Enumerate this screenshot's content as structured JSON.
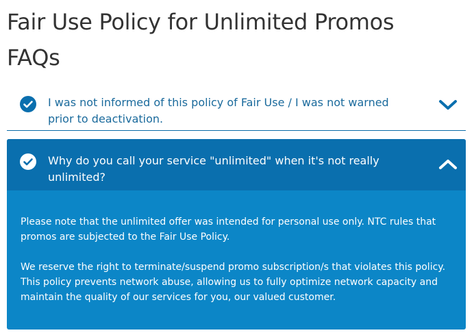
{
  "page": {
    "title": "Fair Use Policy for Unlimited Promos FAQs"
  },
  "colors": {
    "accent": "#0a6fae",
    "panel": "#0c86c7",
    "link_text": "#1a6a9c"
  },
  "faqs": [
    {
      "question": "I was not informed of this policy of Fair Use / I was not warned prior to deactivation.",
      "expanded": false,
      "check_icon": "check-circle-icon",
      "toggle_icon": "chevron-down-icon"
    },
    {
      "question": "Why do you call your service \"unlimited\" when it's not really unlimited?",
      "expanded": true,
      "check_icon": "check-circle-icon",
      "toggle_icon": "chevron-up-icon",
      "answer": [
        "Please note that the unlimited offer was intended for personal use only. NTC rules that promos are subjected to the Fair Use Policy.",
        "We reserve the right to terminate/suspend promo subscription/s that violates this policy. This policy prevents network abuse, allowing us to fully optimize network capacity and maintain the quality of our services for you, our valued customer."
      ]
    }
  ]
}
